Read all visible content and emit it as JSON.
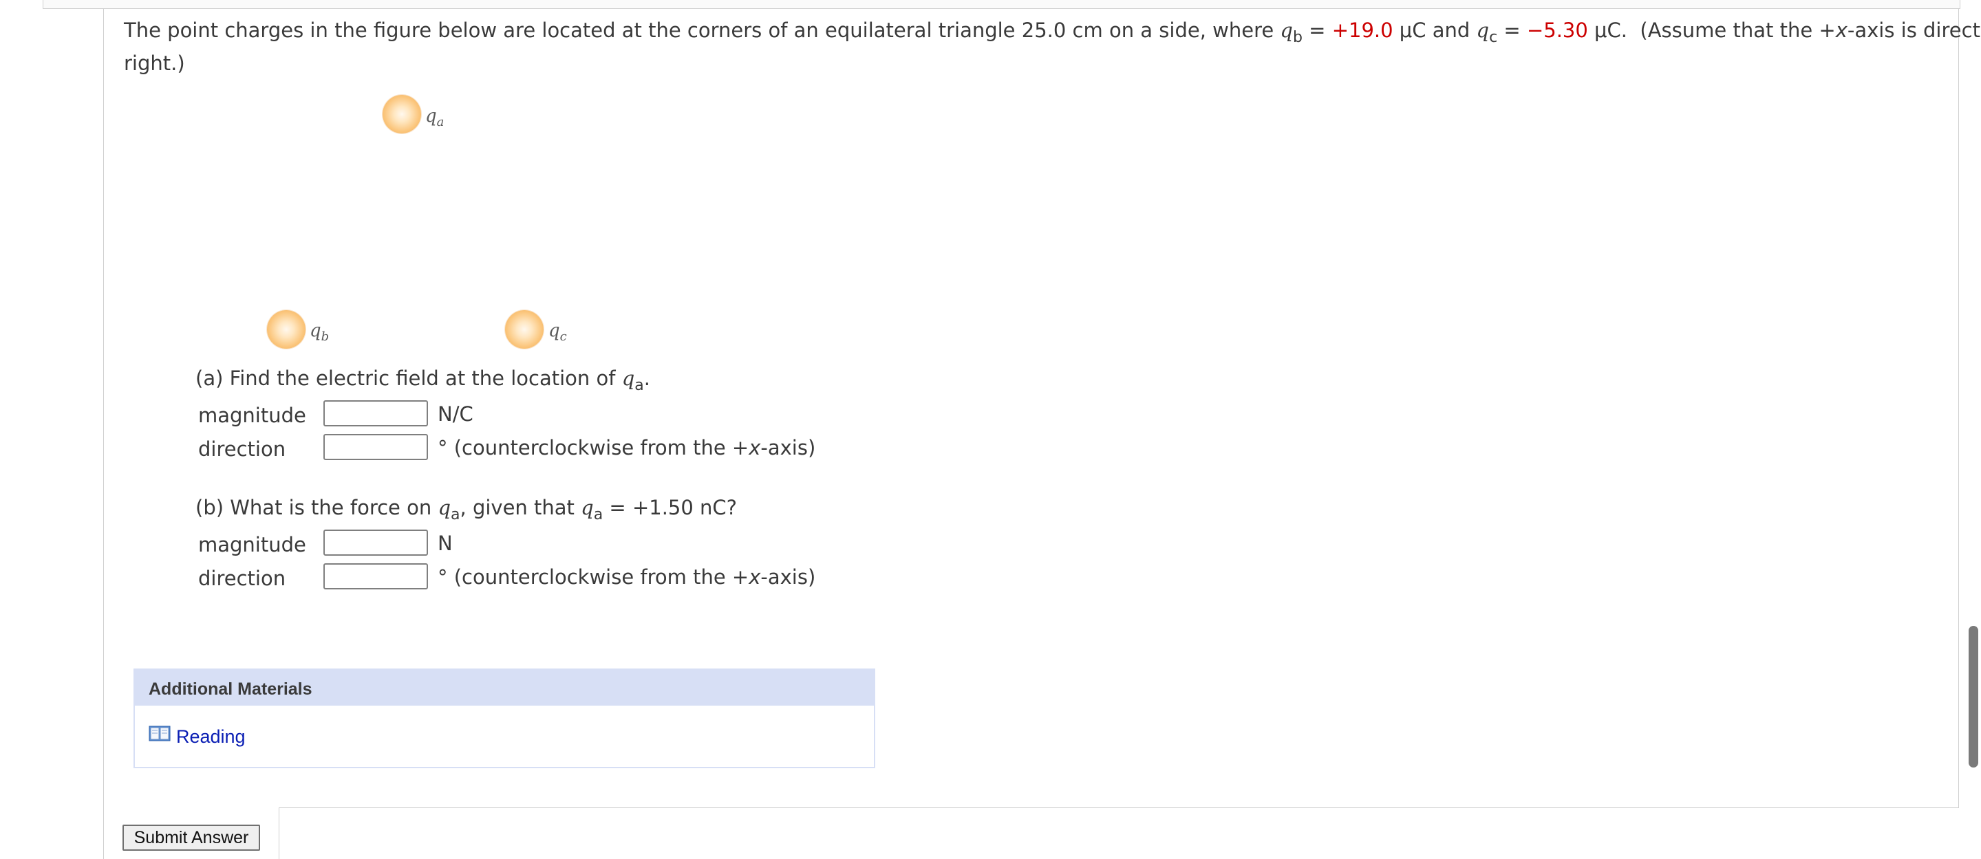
{
  "problem": {
    "intro_part1": "The point charges in the figure below are located at the corners of an equilateral triangle 25.0 cm on a side, where ",
    "qb_symbol": "q",
    "qb_sub": "b",
    "eq": " = ",
    "qb_value": "+19.0",
    "unit_and": " μC and ",
    "qc_symbol": "q",
    "qc_sub": "c",
    "qc_value": "−5.30",
    "unit_end": " μC.",
    "assume_part1": "(Assume that the +",
    "assume_x": "x",
    "assume_part2": "-axis is directed to the",
    "line2": "right.)"
  },
  "figure": {
    "label_a_sym": "q",
    "label_a_sub": "a",
    "label_b_sym": "q",
    "label_b_sub": "b",
    "label_c_sym": "q",
    "label_c_sub": "c"
  },
  "part_a": {
    "prompt": "(a) Find the electric field at the location of ",
    "q_sym": "q",
    "q_sub": "a",
    "end": ".",
    "magnitude_label": "magnitude",
    "magnitude_unit": "N/C",
    "magnitude_value": "",
    "direction_label": "direction",
    "direction_unit_part1": "° (counterclockwise from the +",
    "direction_unit_x": "x",
    "direction_unit_part2": "-axis)",
    "direction_value": ""
  },
  "part_b": {
    "prompt_part1": "(b) What is the force on ",
    "q_sym": "q",
    "q_sub": "a",
    "prompt_part2": ", given that ",
    "q2_sym": "q",
    "q2_sub": "a",
    "prompt_part3": " = +1.50 nC?",
    "magnitude_label": "magnitude",
    "magnitude_unit": "N",
    "magnitude_value": "",
    "direction_label": "direction",
    "direction_unit_part1": "° (counterclockwise from the +",
    "direction_unit_x": "x",
    "direction_unit_part2": "-axis)",
    "direction_value": ""
  },
  "additional": {
    "title": "Additional Materials",
    "reading": "Reading",
    "icon": "book-icon"
  },
  "actions": {
    "submit_label": "Submit Answer"
  },
  "colors": {
    "given_value": "#cc0000",
    "link": "#0a1eb4",
    "panel_header": "#d7dff5"
  }
}
